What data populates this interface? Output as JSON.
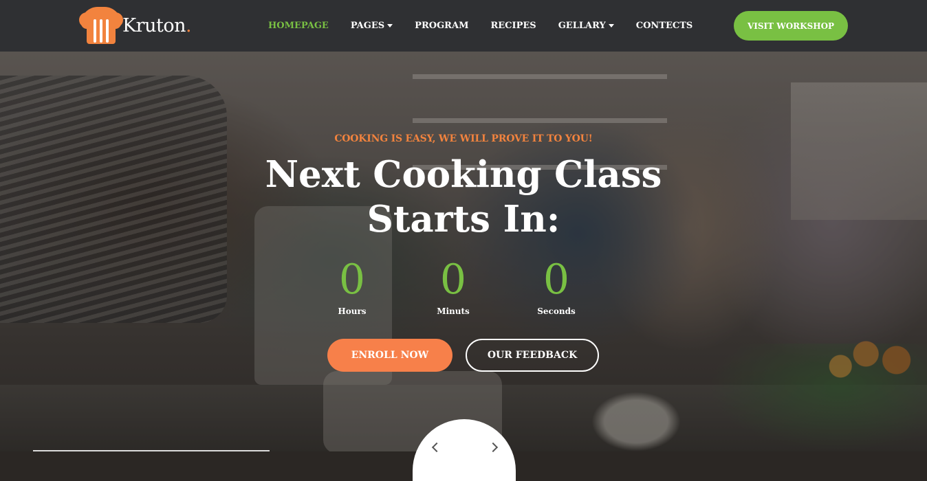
{
  "brand": {
    "name": "Kruton",
    "dot": ".",
    "accent_color": "#f2833e",
    "green_color": "#79c043"
  },
  "nav": {
    "items": [
      {
        "label": "HOMEPAGE",
        "active": true,
        "dropdown": false
      },
      {
        "label": "PAGES",
        "active": false,
        "dropdown": true
      },
      {
        "label": "PROGRAM",
        "active": false,
        "dropdown": false
      },
      {
        "label": "RECIPES",
        "active": false,
        "dropdown": false
      },
      {
        "label": "GELLARY",
        "active": false,
        "dropdown": true
      },
      {
        "label": "CONTECTS",
        "active": false,
        "dropdown": false
      }
    ],
    "cta_label": "VISIT WORKSHOP"
  },
  "hero": {
    "tagline": "COOKING IS EASY, WE WILL PROVE IT TO YOU!",
    "headline_line1": "Next Cooking Class",
    "headline_line2": "Starts In:",
    "countdown": [
      {
        "value": "0",
        "label": "Hours"
      },
      {
        "value": "0",
        "label": "Minuts"
      },
      {
        "value": "0",
        "label": "Seconds"
      }
    ],
    "enroll_label": "ENROLL NOW",
    "feedback_label": "OUR FEEDBACK"
  },
  "icons": {
    "logo": "chef-hat-icon",
    "caret": "chevron-down-icon",
    "scroll": "chevron-left-right-icon"
  }
}
